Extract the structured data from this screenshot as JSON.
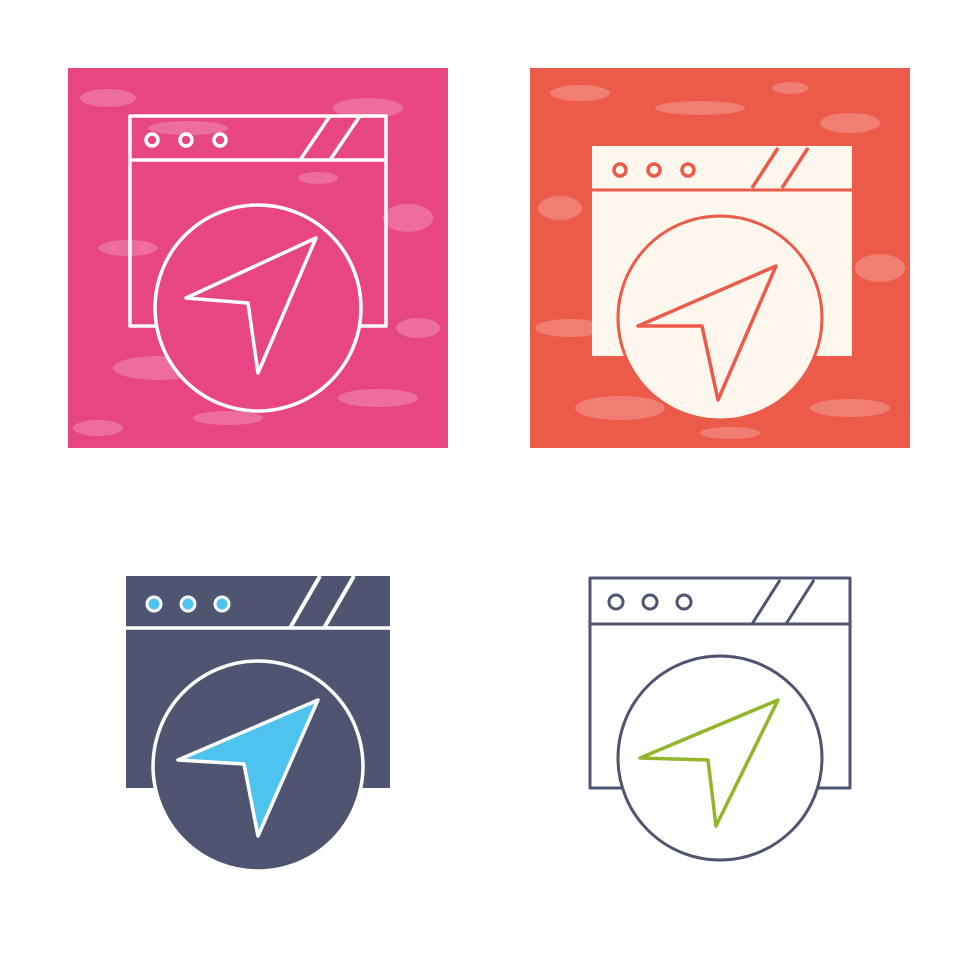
{
  "icons": [
    {
      "name": "browser-navigation-icon-pink",
      "style": "textured background, white outline",
      "colors": {
        "background": "#e84583",
        "stroke": "#ffffff"
      }
    },
    {
      "name": "browser-navigation-icon-red",
      "style": "textured background, white fill, red outline arrow",
      "colors": {
        "background": "#ec5a4a",
        "fill": "#fdf7ee",
        "stroke": "#ec5a4a"
      }
    },
    {
      "name": "browser-navigation-icon-glyph",
      "style": "solid glyph",
      "colors": {
        "fill": "#4f5570",
        "accent": "#4ec3ef",
        "stroke": "#ffffff"
      }
    },
    {
      "name": "browser-navigation-icon-line",
      "style": "line icon",
      "colors": {
        "stroke": "#4f5570",
        "accent": "#93b52a"
      }
    }
  ]
}
